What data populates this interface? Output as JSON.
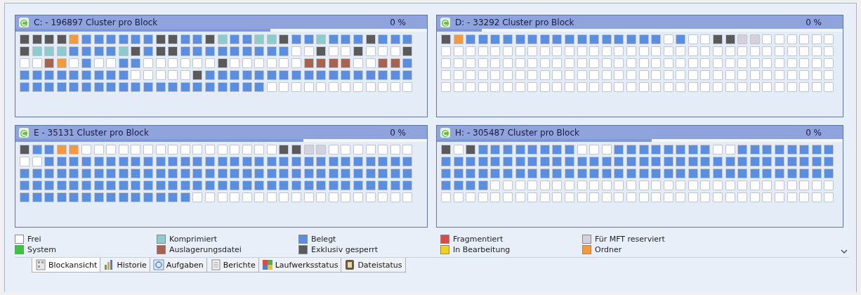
{
  "panels": [
    {
      "title": "C: - 196897 Cluster pro Block",
      "percent": "0 %",
      "level": 0.62,
      "rows": [
        [
          {
            "kind": "locked"
          },
          {
            "kind": "locked"
          },
          {
            "kind": "locked"
          },
          {
            "kind": "locked"
          },
          {
            "kind": "folder"
          },
          {
            "kind": "used"
          },
          {
            "kind": "used"
          },
          {
            "kind": "used"
          },
          {
            "kind": "used"
          },
          {
            "kind": "used"
          },
          {
            "kind": "used"
          },
          {
            "kind": "locked"
          },
          {
            "kind": "locked"
          },
          {
            "kind": "used"
          },
          {
            "kind": "used"
          },
          {
            "kind": "locked"
          },
          {
            "kind": "compressed"
          },
          {
            "kind": "used"
          },
          {
            "kind": "used"
          },
          {
            "kind": "compressed"
          },
          {
            "kind": "compressed"
          },
          {
            "kind": "locked"
          },
          {
            "kind": "used"
          },
          {
            "kind": "used"
          },
          {
            "kind": "compressed"
          },
          {
            "kind": "used"
          },
          {
            "kind": "used"
          },
          {
            "kind": "used"
          },
          {
            "kind": "locked"
          },
          {
            "kind": "used"
          },
          {
            "kind": "used"
          },
          {
            "kind": "used"
          }
        ],
        [
          {
            "kind": "locked"
          },
          {
            "kind": "compressed"
          },
          {
            "kind": "compressed"
          },
          {
            "kind": "compressed"
          },
          {
            "kind": "used"
          },
          {
            "kind": "used"
          },
          {
            "kind": "used"
          },
          {
            "kind": "used"
          },
          {
            "kind": "compressed"
          },
          {
            "kind": "locked"
          },
          {
            "kind": "used"
          },
          {
            "kind": "locked"
          },
          {
            "kind": "locked"
          },
          {
            "kind": "used"
          },
          {
            "kind": "used"
          },
          {
            "kind": "used"
          },
          {
            "kind": "used"
          },
          {
            "kind": "used"
          },
          {
            "kind": "used"
          },
          {
            "kind": "used"
          },
          {
            "kind": "used"
          },
          {
            "kind": "used"
          },
          {
            "kind": "free"
          },
          {
            "kind": "free"
          },
          {
            "kind": "locked"
          },
          {
            "kind": "free"
          },
          {
            "kind": "free"
          },
          {
            "kind": "locked"
          },
          {
            "kind": "free"
          },
          {
            "kind": "free"
          },
          {
            "kind": "free"
          },
          {
            "kind": "locked"
          }
        ],
        [
          {
            "kind": "free"
          },
          {
            "kind": "free"
          },
          {
            "kind": "swap"
          },
          {
            "kind": "folder"
          },
          {
            "kind": "free"
          },
          {
            "kind": "used"
          },
          {
            "kind": "free"
          },
          {
            "kind": "free"
          },
          {
            "kind": "used"
          },
          {
            "kind": "used"
          },
          {
            "kind": "free"
          },
          {
            "kind": "free"
          },
          {
            "kind": "free"
          },
          {
            "kind": "free"
          },
          {
            "kind": "free"
          },
          {
            "kind": "free"
          },
          {
            "kind": "locked"
          },
          {
            "kind": "free"
          },
          {
            "kind": "free"
          },
          {
            "kind": "free"
          },
          {
            "kind": "free"
          },
          {
            "kind": "free"
          },
          {
            "kind": "free"
          },
          {
            "kind": "swap"
          },
          {
            "kind": "swap"
          },
          {
            "kind": "swap"
          },
          {
            "kind": "swap"
          },
          {
            "kind": "free"
          },
          {
            "kind": "free"
          },
          {
            "kind": "swap"
          },
          {
            "kind": "swap"
          },
          {
            "kind": "used"
          }
        ],
        [
          {
            "kind": "used"
          },
          {
            "kind": "used"
          },
          {
            "kind": "used"
          },
          {
            "kind": "used"
          },
          {
            "kind": "used"
          },
          {
            "kind": "used"
          },
          {
            "kind": "used"
          },
          {
            "kind": "used"
          },
          {
            "kind": "used"
          },
          {
            "kind": "free"
          },
          {
            "kind": "free"
          },
          {
            "kind": "free"
          },
          {
            "kind": "free"
          },
          {
            "kind": "free"
          },
          {
            "kind": "locked"
          },
          {
            "kind": "used"
          },
          {
            "kind": "used"
          },
          {
            "kind": "used"
          },
          {
            "kind": "used"
          },
          {
            "kind": "used"
          },
          {
            "kind": "used"
          },
          {
            "kind": "used"
          },
          {
            "kind": "used"
          },
          {
            "kind": "used"
          },
          {
            "kind": "used"
          },
          {
            "kind": "used"
          },
          {
            "kind": "used"
          },
          {
            "kind": "used"
          },
          {
            "kind": "used"
          },
          {
            "kind": "used"
          },
          {
            "kind": "used"
          },
          {
            "kind": "used"
          }
        ],
        [
          {
            "kind": "used"
          },
          {
            "kind": "used"
          },
          {
            "kind": "used"
          },
          {
            "kind": "used"
          },
          {
            "kind": "used"
          },
          {
            "kind": "used"
          },
          {
            "kind": "used"
          },
          {
            "kind": "used"
          },
          {
            "kind": "used"
          },
          {
            "kind": "used"
          },
          {
            "kind": "used"
          },
          {
            "kind": "used"
          },
          {
            "kind": "used"
          },
          {
            "kind": "used"
          },
          {
            "kind": "used"
          },
          {
            "kind": "used"
          },
          {
            "kind": "used"
          },
          {
            "kind": "used"
          },
          {
            "kind": "used"
          },
          {
            "kind": "used"
          },
          {
            "kind": "free"
          },
          {
            "kind": "free"
          },
          {
            "kind": "free"
          },
          {
            "kind": "free"
          },
          {
            "kind": "free"
          },
          {
            "kind": "free"
          },
          {
            "kind": "free"
          },
          {
            "kind": "free"
          },
          {
            "kind": "free"
          },
          {
            "kind": "free"
          },
          {
            "kind": "free"
          },
          {
            "kind": "free"
          }
        ]
      ]
    },
    {
      "title": "D: - 33292 Cluster pro Block",
      "percent": "0 %",
      "level": 0.11,
      "rows": [
        [
          {
            "kind": "locked"
          },
          {
            "kind": "folder"
          },
          {
            "kind": "used"
          },
          {
            "kind": "used"
          },
          {
            "kind": "used"
          },
          {
            "kind": "used"
          },
          {
            "kind": "used"
          },
          {
            "kind": "used"
          },
          {
            "kind": "used"
          },
          {
            "kind": "used"
          },
          {
            "kind": "used"
          },
          {
            "kind": "used"
          },
          {
            "kind": "used"
          },
          {
            "kind": "used"
          },
          {
            "kind": "used"
          },
          {
            "kind": "used"
          },
          {
            "kind": "used"
          },
          {
            "kind": "used"
          },
          {
            "kind": "free"
          },
          {
            "kind": "used"
          },
          {
            "kind": "free"
          },
          {
            "kind": "free"
          },
          {
            "kind": "locked"
          },
          {
            "kind": "locked"
          },
          {
            "kind": "mft"
          },
          {
            "kind": "mft"
          },
          {
            "kind": "free"
          },
          {
            "kind": "free"
          },
          {
            "kind": "free"
          },
          {
            "kind": "free"
          },
          {
            "kind": "free"
          },
          {
            "kind": "free"
          }
        ],
        [
          {
            "kind": "free"
          },
          {
            "kind": "free"
          },
          {
            "kind": "free"
          },
          {
            "kind": "free"
          },
          {
            "kind": "free"
          },
          {
            "kind": "free"
          },
          {
            "kind": "free"
          },
          {
            "kind": "free"
          },
          {
            "kind": "free"
          },
          {
            "kind": "free"
          },
          {
            "kind": "free"
          },
          {
            "kind": "free"
          },
          {
            "kind": "free"
          },
          {
            "kind": "free"
          },
          {
            "kind": "free"
          },
          {
            "kind": "free"
          },
          {
            "kind": "free"
          },
          {
            "kind": "free"
          },
          {
            "kind": "free"
          },
          {
            "kind": "free"
          },
          {
            "kind": "free"
          },
          {
            "kind": "free"
          },
          {
            "kind": "free"
          },
          {
            "kind": "free"
          },
          {
            "kind": "free"
          },
          {
            "kind": "free"
          },
          {
            "kind": "free"
          },
          {
            "kind": "free"
          },
          {
            "kind": "free"
          },
          {
            "kind": "free"
          },
          {
            "kind": "free"
          },
          {
            "kind": "free"
          }
        ],
        [
          {
            "kind": "free"
          },
          {
            "kind": "free"
          },
          {
            "kind": "free"
          },
          {
            "kind": "free"
          },
          {
            "kind": "free"
          },
          {
            "kind": "free"
          },
          {
            "kind": "free"
          },
          {
            "kind": "free"
          },
          {
            "kind": "free"
          },
          {
            "kind": "free"
          },
          {
            "kind": "free"
          },
          {
            "kind": "free"
          },
          {
            "kind": "free"
          },
          {
            "kind": "free"
          },
          {
            "kind": "free"
          },
          {
            "kind": "free"
          },
          {
            "kind": "free"
          },
          {
            "kind": "free"
          },
          {
            "kind": "free"
          },
          {
            "kind": "free"
          },
          {
            "kind": "free"
          },
          {
            "kind": "free"
          },
          {
            "kind": "free"
          },
          {
            "kind": "free"
          },
          {
            "kind": "free"
          },
          {
            "kind": "free"
          },
          {
            "kind": "free"
          },
          {
            "kind": "free"
          },
          {
            "kind": "free"
          },
          {
            "kind": "free"
          },
          {
            "kind": "free"
          },
          {
            "kind": "free"
          }
        ],
        [
          {
            "kind": "free"
          },
          {
            "kind": "free"
          },
          {
            "kind": "free"
          },
          {
            "kind": "free"
          },
          {
            "kind": "free"
          },
          {
            "kind": "free"
          },
          {
            "kind": "free"
          },
          {
            "kind": "free"
          },
          {
            "kind": "free"
          },
          {
            "kind": "free"
          },
          {
            "kind": "free"
          },
          {
            "kind": "free"
          },
          {
            "kind": "free"
          },
          {
            "kind": "free"
          },
          {
            "kind": "free"
          },
          {
            "kind": "free"
          },
          {
            "kind": "free"
          },
          {
            "kind": "free"
          },
          {
            "kind": "free"
          },
          {
            "kind": "free"
          },
          {
            "kind": "free"
          },
          {
            "kind": "free"
          },
          {
            "kind": "free"
          },
          {
            "kind": "free"
          },
          {
            "kind": "free"
          },
          {
            "kind": "free"
          },
          {
            "kind": "free"
          },
          {
            "kind": "free"
          },
          {
            "kind": "free"
          },
          {
            "kind": "free"
          },
          {
            "kind": "free"
          },
          {
            "kind": "free"
          }
        ],
        [
          {
            "kind": "free"
          },
          {
            "kind": "free"
          },
          {
            "kind": "free"
          },
          {
            "kind": "free"
          },
          {
            "kind": "free"
          },
          {
            "kind": "free"
          },
          {
            "kind": "free"
          },
          {
            "kind": "free"
          },
          {
            "kind": "free"
          },
          {
            "kind": "free"
          },
          {
            "kind": "free"
          },
          {
            "kind": "free"
          },
          {
            "kind": "free"
          },
          {
            "kind": "free"
          },
          {
            "kind": "free"
          },
          {
            "kind": "free"
          },
          {
            "kind": "free"
          },
          {
            "kind": "free"
          },
          {
            "kind": "free"
          },
          {
            "kind": "free"
          },
          {
            "kind": "free"
          },
          {
            "kind": "free"
          },
          {
            "kind": "free"
          },
          {
            "kind": "free"
          },
          {
            "kind": "free"
          },
          {
            "kind": "free"
          },
          {
            "kind": "free"
          },
          {
            "kind": "free"
          },
          {
            "kind": "free"
          },
          {
            "kind": "free"
          },
          {
            "kind": "free"
          },
          {
            "kind": "free"
          }
        ]
      ]
    },
    {
      "title": "E - 35131 Cluster pro Block",
      "percent": "0 %",
      "level": 0.7,
      "rows": [
        [
          {
            "kind": "locked"
          },
          {
            "kind": "used"
          },
          {
            "kind": "used"
          },
          {
            "kind": "folder"
          },
          {
            "kind": "folder"
          },
          {
            "kind": "free"
          },
          {
            "kind": "free"
          },
          {
            "kind": "free"
          },
          {
            "kind": "free"
          },
          {
            "kind": "free"
          },
          {
            "kind": "free"
          },
          {
            "kind": "free"
          },
          {
            "kind": "free"
          },
          {
            "kind": "free"
          },
          {
            "kind": "free"
          },
          {
            "kind": "free"
          },
          {
            "kind": "free"
          },
          {
            "kind": "free"
          },
          {
            "kind": "free"
          },
          {
            "kind": "free"
          },
          {
            "kind": "free"
          },
          {
            "kind": "locked"
          },
          {
            "kind": "locked"
          },
          {
            "kind": "mft"
          },
          {
            "kind": "mft"
          },
          {
            "kind": "free"
          },
          {
            "kind": "free"
          },
          {
            "kind": "free"
          },
          {
            "kind": "free"
          },
          {
            "kind": "free"
          },
          {
            "kind": "free"
          },
          {
            "kind": "free"
          }
        ],
        [
          {
            "kind": "free"
          },
          {
            "kind": "free"
          },
          {
            "kind": "used"
          },
          {
            "kind": "used"
          },
          {
            "kind": "used"
          },
          {
            "kind": "used"
          },
          {
            "kind": "used"
          },
          {
            "kind": "used"
          },
          {
            "kind": "used"
          },
          {
            "kind": "used"
          },
          {
            "kind": "used"
          },
          {
            "kind": "used"
          },
          {
            "kind": "used"
          },
          {
            "kind": "used"
          },
          {
            "kind": "used"
          },
          {
            "kind": "used"
          },
          {
            "kind": "used"
          },
          {
            "kind": "used"
          },
          {
            "kind": "used"
          },
          {
            "kind": "used"
          },
          {
            "kind": "used"
          },
          {
            "kind": "used"
          },
          {
            "kind": "used"
          },
          {
            "kind": "used"
          },
          {
            "kind": "used"
          },
          {
            "kind": "used"
          },
          {
            "kind": "used"
          },
          {
            "kind": "used"
          },
          {
            "kind": "used"
          },
          {
            "kind": "used"
          },
          {
            "kind": "used"
          },
          {
            "kind": "used"
          }
        ],
        [
          {
            "kind": "used"
          },
          {
            "kind": "used"
          },
          {
            "kind": "used"
          },
          {
            "kind": "used"
          },
          {
            "kind": "used"
          },
          {
            "kind": "used"
          },
          {
            "kind": "used"
          },
          {
            "kind": "used"
          },
          {
            "kind": "used"
          },
          {
            "kind": "used"
          },
          {
            "kind": "used"
          },
          {
            "kind": "used"
          },
          {
            "kind": "used"
          },
          {
            "kind": "used"
          },
          {
            "kind": "used"
          },
          {
            "kind": "used"
          },
          {
            "kind": "used"
          },
          {
            "kind": "used"
          },
          {
            "kind": "used"
          },
          {
            "kind": "used"
          },
          {
            "kind": "used"
          },
          {
            "kind": "used"
          },
          {
            "kind": "used"
          },
          {
            "kind": "used"
          },
          {
            "kind": "used"
          },
          {
            "kind": "used"
          },
          {
            "kind": "used"
          },
          {
            "kind": "used"
          },
          {
            "kind": "used"
          },
          {
            "kind": "used"
          },
          {
            "kind": "used"
          },
          {
            "kind": "used"
          }
        ],
        [
          {
            "kind": "used"
          },
          {
            "kind": "used"
          },
          {
            "kind": "used"
          },
          {
            "kind": "used"
          },
          {
            "kind": "used"
          },
          {
            "kind": "used"
          },
          {
            "kind": "used"
          },
          {
            "kind": "used"
          },
          {
            "kind": "used"
          },
          {
            "kind": "used"
          },
          {
            "kind": "used"
          },
          {
            "kind": "used"
          },
          {
            "kind": "used"
          },
          {
            "kind": "used"
          },
          {
            "kind": "used"
          },
          {
            "kind": "used"
          },
          {
            "kind": "used"
          },
          {
            "kind": "used"
          },
          {
            "kind": "used"
          },
          {
            "kind": "used"
          },
          {
            "kind": "used"
          },
          {
            "kind": "used"
          },
          {
            "kind": "used"
          },
          {
            "kind": "used"
          },
          {
            "kind": "used"
          },
          {
            "kind": "used"
          },
          {
            "kind": "used"
          },
          {
            "kind": "used"
          },
          {
            "kind": "used"
          },
          {
            "kind": "used"
          },
          {
            "kind": "used"
          },
          {
            "kind": "used"
          }
        ],
        [
          {
            "kind": "used"
          },
          {
            "kind": "used"
          },
          {
            "kind": "used"
          },
          {
            "kind": "used"
          },
          {
            "kind": "used"
          },
          {
            "kind": "used"
          },
          {
            "kind": "used"
          },
          {
            "kind": "used"
          },
          {
            "kind": "used"
          },
          {
            "kind": "used"
          },
          {
            "kind": "used"
          },
          {
            "kind": "used"
          },
          {
            "kind": "used"
          },
          {
            "kind": "used"
          },
          {
            "kind": "free"
          },
          {
            "kind": "free"
          },
          {
            "kind": "free"
          },
          {
            "kind": "free"
          },
          {
            "kind": "free"
          },
          {
            "kind": "free"
          },
          {
            "kind": "free"
          },
          {
            "kind": "free"
          },
          {
            "kind": "free"
          },
          {
            "kind": "free"
          },
          {
            "kind": "free"
          },
          {
            "kind": "free"
          },
          {
            "kind": "free"
          },
          {
            "kind": "free"
          },
          {
            "kind": "free"
          },
          {
            "kind": "free"
          },
          {
            "kind": "free"
          },
          {
            "kind": "free"
          }
        ]
      ]
    },
    {
      "title": "H: - 305487 Cluster pro Block",
      "percent": "0 %",
      "level": 0.53,
      "rows": [
        [
          {
            "kind": "locked"
          },
          {
            "kind": "free"
          },
          {
            "kind": "locked"
          },
          {
            "kind": "used"
          },
          {
            "kind": "used"
          },
          {
            "kind": "used"
          },
          {
            "kind": "used"
          },
          {
            "kind": "used"
          },
          {
            "kind": "used"
          },
          {
            "kind": "used"
          },
          {
            "kind": "used"
          },
          {
            "kind": "free"
          },
          {
            "kind": "free"
          },
          {
            "kind": "free"
          },
          {
            "kind": "used"
          },
          {
            "kind": "used"
          },
          {
            "kind": "used"
          },
          {
            "kind": "used"
          },
          {
            "kind": "used"
          },
          {
            "kind": "used"
          },
          {
            "kind": "used"
          },
          {
            "kind": "used"
          },
          {
            "kind": "free"
          },
          {
            "kind": "free"
          },
          {
            "kind": "used"
          },
          {
            "kind": "used"
          },
          {
            "kind": "used"
          },
          {
            "kind": "used"
          },
          {
            "kind": "used"
          },
          {
            "kind": "used"
          },
          {
            "kind": "used"
          },
          {
            "kind": "used"
          }
        ],
        [
          {
            "kind": "used"
          },
          {
            "kind": "used"
          },
          {
            "kind": "used"
          },
          {
            "kind": "used"
          },
          {
            "kind": "used"
          },
          {
            "kind": "used"
          },
          {
            "kind": "used"
          },
          {
            "kind": "used"
          },
          {
            "kind": "used"
          },
          {
            "kind": "used"
          },
          {
            "kind": "used"
          },
          {
            "kind": "used"
          },
          {
            "kind": "used"
          },
          {
            "kind": "used"
          },
          {
            "kind": "used"
          },
          {
            "kind": "used"
          },
          {
            "kind": "used"
          },
          {
            "kind": "used"
          },
          {
            "kind": "used"
          },
          {
            "kind": "used"
          },
          {
            "kind": "used"
          },
          {
            "kind": "used"
          },
          {
            "kind": "used"
          },
          {
            "kind": "used"
          },
          {
            "kind": "used"
          },
          {
            "kind": "used"
          },
          {
            "kind": "used"
          },
          {
            "kind": "used"
          },
          {
            "kind": "used"
          },
          {
            "kind": "used"
          },
          {
            "kind": "used"
          },
          {
            "kind": "used"
          }
        ],
        [
          {
            "kind": "used"
          },
          {
            "kind": "used"
          },
          {
            "kind": "used"
          },
          {
            "kind": "used"
          },
          {
            "kind": "used"
          },
          {
            "kind": "used"
          },
          {
            "kind": "used"
          },
          {
            "kind": "used"
          },
          {
            "kind": "used"
          },
          {
            "kind": "used"
          },
          {
            "kind": "used"
          },
          {
            "kind": "used"
          },
          {
            "kind": "used"
          },
          {
            "kind": "used"
          },
          {
            "kind": "used"
          },
          {
            "kind": "used"
          },
          {
            "kind": "used"
          },
          {
            "kind": "used"
          },
          {
            "kind": "used"
          },
          {
            "kind": "used"
          },
          {
            "kind": "used"
          },
          {
            "kind": "used"
          },
          {
            "kind": "used"
          },
          {
            "kind": "used"
          },
          {
            "kind": "used"
          },
          {
            "kind": "used"
          },
          {
            "kind": "used"
          },
          {
            "kind": "used"
          },
          {
            "kind": "used"
          },
          {
            "kind": "used"
          },
          {
            "kind": "used"
          },
          {
            "kind": "used"
          }
        ],
        [
          {
            "kind": "used"
          },
          {
            "kind": "used"
          },
          {
            "kind": "used"
          },
          {
            "kind": "used"
          },
          {
            "kind": "free"
          },
          {
            "kind": "free"
          },
          {
            "kind": "free"
          },
          {
            "kind": "free"
          },
          {
            "kind": "free"
          },
          {
            "kind": "free"
          },
          {
            "kind": "free"
          },
          {
            "kind": "free"
          },
          {
            "kind": "free"
          },
          {
            "kind": "free"
          },
          {
            "kind": "free"
          },
          {
            "kind": "free"
          },
          {
            "kind": "free"
          },
          {
            "kind": "free"
          },
          {
            "kind": "free"
          },
          {
            "kind": "free"
          },
          {
            "kind": "free"
          },
          {
            "kind": "free"
          },
          {
            "kind": "free"
          },
          {
            "kind": "free"
          },
          {
            "kind": "free"
          },
          {
            "kind": "free"
          },
          {
            "kind": "free"
          },
          {
            "kind": "free"
          },
          {
            "kind": "free"
          },
          {
            "kind": "free"
          },
          {
            "kind": "free"
          },
          {
            "kind": "free"
          }
        ],
        [
          {
            "kind": "free"
          },
          {
            "kind": "free"
          },
          {
            "kind": "free"
          },
          {
            "kind": "free"
          },
          {
            "kind": "free"
          },
          {
            "kind": "free"
          },
          {
            "kind": "free"
          },
          {
            "kind": "free"
          },
          {
            "kind": "free"
          },
          {
            "kind": "free"
          },
          {
            "kind": "free"
          },
          {
            "kind": "free"
          },
          {
            "kind": "free"
          },
          {
            "kind": "free"
          },
          {
            "kind": "free"
          },
          {
            "kind": "free"
          },
          {
            "kind": "free"
          },
          {
            "kind": "free"
          },
          {
            "kind": "free"
          },
          {
            "kind": "free"
          },
          {
            "kind": "free"
          },
          {
            "kind": "free"
          },
          {
            "kind": "free"
          },
          {
            "kind": "free"
          },
          {
            "kind": "free"
          },
          {
            "kind": "free"
          },
          {
            "kind": "free"
          },
          {
            "kind": "free"
          },
          {
            "kind": "free"
          },
          {
            "kind": "free"
          },
          {
            "kind": "free"
          },
          {
            "kind": "free"
          }
        ]
      ]
    }
  ],
  "legend": [
    {
      "label": "Frei",
      "kind": "free",
      "color": "#ffffff"
    },
    {
      "label": "System",
      "kind": "system",
      "color": "#3cc43c"
    },
    {
      "label": "Komprimiert",
      "kind": "compressed",
      "color": "#8ccccc"
    },
    {
      "label": "Auslagerungsdatei",
      "kind": "swap",
      "color": "#a8634f"
    },
    {
      "label": "Belegt",
      "kind": "used",
      "color": "#5a8ee0"
    },
    {
      "label": "Exklusiv gesperrt",
      "kind": "locked",
      "color": "#5a5a5a"
    },
    {
      "label": "Fragmentiert",
      "kind": "fragmented",
      "color": "#e04848"
    },
    {
      "label": "In Bearbeitung",
      "kind": "processing",
      "color": "#f0d020"
    },
    {
      "label": "Für MFT reserviert",
      "kind": "mft",
      "color": "#d4d0dc"
    },
    {
      "label": "Ordner",
      "kind": "folder",
      "color": "#f49a3c"
    }
  ],
  "tabs": [
    {
      "label": "Blockansicht",
      "selected": true
    },
    {
      "label": "Historie",
      "selected": false
    },
    {
      "label": "Aufgaben",
      "selected": false
    },
    {
      "label": "Berichte",
      "selected": false
    },
    {
      "label": "Laufwerksstatus",
      "selected": false
    },
    {
      "label": "Dateistatus",
      "selected": false
    }
  ]
}
